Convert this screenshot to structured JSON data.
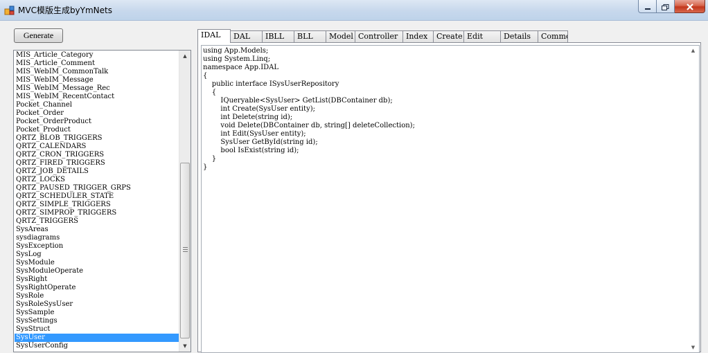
{
  "window": {
    "title": "MVC模版生成byYmNets",
    "icons": {
      "app": "app-icon",
      "minimize": "minimize-icon",
      "maximize": "maximize-icon",
      "close": "close-icon"
    }
  },
  "toolbar": {
    "generate_label": "Generate"
  },
  "table_list": {
    "items": [
      "MIS_Article_Category",
      "MIS_Article_Comment",
      "MIS_WebIM_CommonTalk",
      "MIS_WebIM_Message",
      "MIS_WebIM_Message_Rec",
      "MIS_WebIM_RecentContact",
      "Pocket_Channel",
      "Pocket_Order",
      "Pocket_OrderProduct",
      "Pocket_Product",
      "QRTZ_BLOB_TRIGGERS",
      "QRTZ_CALENDARS",
      "QRTZ_CRON_TRIGGERS",
      "QRTZ_FIRED_TRIGGERS",
      "QRTZ_JOB_DETAILS",
      "QRTZ_LOCKS",
      "QRTZ_PAUSED_TRIGGER_GRPS",
      "QRTZ_SCHEDULER_STATE",
      "QRTZ_SIMPLE_TRIGGERS",
      "QRTZ_SIMPROP_TRIGGERS",
      "QRTZ_TRIGGERS",
      "SysAreas",
      "sysdiagrams",
      "SysException",
      "SysLog",
      "SysModule",
      "SysModuleOperate",
      "SysRight",
      "SysRightOperate",
      "SysRole",
      "SysRoleSysUser",
      "SysSample",
      "SysSettings",
      "SysStruct",
      "SysUser",
      "SysUserConfig"
    ],
    "selected": "SysUser"
  },
  "tabs": [
    {
      "label": "IDAL",
      "active": true
    },
    {
      "label": "DAL"
    },
    {
      "label": "IBLL"
    },
    {
      "label": "BLL"
    },
    {
      "label": "Model"
    },
    {
      "label": "Controller"
    },
    {
      "label": "Index"
    },
    {
      "label": "Create"
    },
    {
      "label": "Edit"
    },
    {
      "label": "Details"
    },
    {
      "label": "Common"
    }
  ],
  "code": {
    "lines": [
      "using App.Models;",
      "using System.Linq;",
      "namespace App.IDAL",
      "{",
      "    public interface ISysUserRepository",
      "    {",
      "        IQueryable<SysUser> GetList(DBContainer db);",
      "        int Create(SysUser entity);",
      "        int Delete(string id);",
      "        void Delete(DBContainer db, string[] deleteCollection);",
      "        int Edit(SysUser entity);",
      "        SysUser GetById(string id);",
      "        bool IsExist(string id);",
      "    }",
      "}"
    ]
  }
}
